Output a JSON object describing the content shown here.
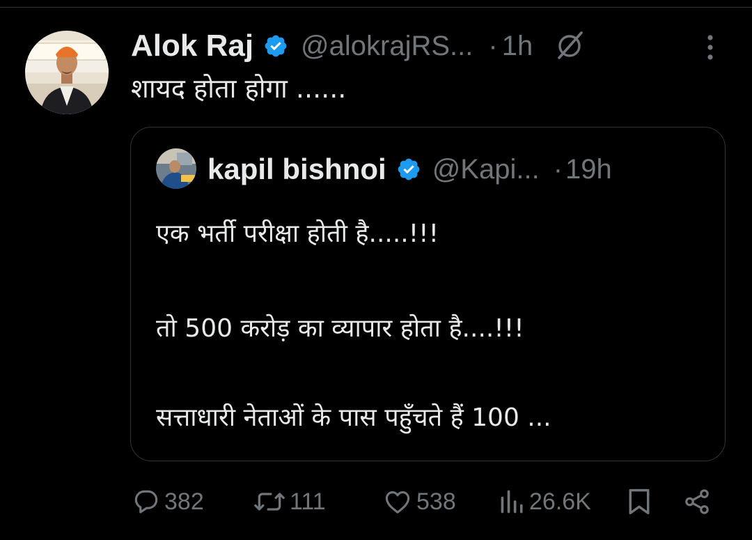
{
  "tweet": {
    "author": {
      "name": "Alok Raj",
      "handle": "@alokrajRS...",
      "verified": true
    },
    "time": "1h",
    "separator": "·",
    "text": "शायद होता होगा ......",
    "quoted": {
      "author": {
        "name": "kapil bishnoi",
        "handle": "@Kapi...",
        "verified": true
      },
      "time": "19h",
      "separator": "·",
      "lines": [
        "एक भर्ती परीक्षा होती है.....!!!",
        "तो 500 करोड़ का व्यापार होता है....!!!",
        "सत्ताधारी नेताओं के पास पहुँचते हैं 100 ..."
      ]
    }
  },
  "actions": {
    "reply_count": "382",
    "repost_count": "111",
    "like_count": "538",
    "view_count": "26.6K"
  },
  "icons": {
    "verified": "verified-badge-icon",
    "grok": "grok-icon",
    "more": "more-vertical-icon",
    "reply": "reply-icon",
    "repost": "repost-icon",
    "like": "heart-icon",
    "views": "views-icon",
    "bookmark": "bookmark-icon",
    "share": "share-icon"
  },
  "colors": {
    "background": "#000000",
    "text": "#e7e9ea",
    "secondary": "#71767b",
    "border": "#2f3336",
    "verified": "#1d9bf0"
  }
}
